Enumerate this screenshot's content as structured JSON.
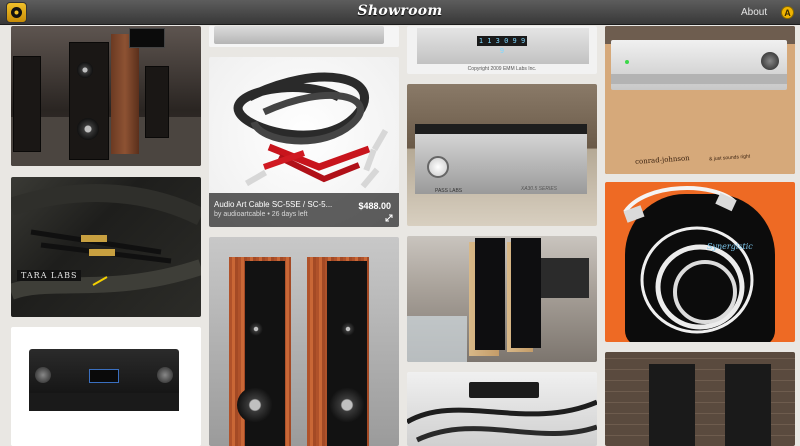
{
  "header": {
    "app_title": "Showroom",
    "about_label": "About",
    "user_badge": "A"
  },
  "tiles": {
    "audio_art_cable": {
      "title": "Audio Art Cable SC-5SE / SC-5...",
      "subtitle": "by audioartcable • 26 days left",
      "price": "$488.00"
    },
    "tara_labs": {
      "brand_text": "TARA LABS"
    },
    "cd_player": {
      "display": "1 1 3 0 9 9 9",
      "copyright": "Copyright 2009 EMM Labs Inc."
    },
    "pass_amp": {
      "brand": "PASS LABS",
      "series": "XA30.5 SERIES"
    },
    "conrad_johnson": {
      "brand": "conrad-johnson",
      "tagline": "& just sounds right"
    },
    "power_cable": {
      "logo": "Synergistic"
    }
  },
  "colors": {
    "header_bg": "#4a4a4a",
    "accent_badge": "#f0b400",
    "background": "#e9e7e3"
  },
  "icons": {
    "app": "vinyl-record-icon",
    "expand": "expand-diagonal-icon"
  }
}
